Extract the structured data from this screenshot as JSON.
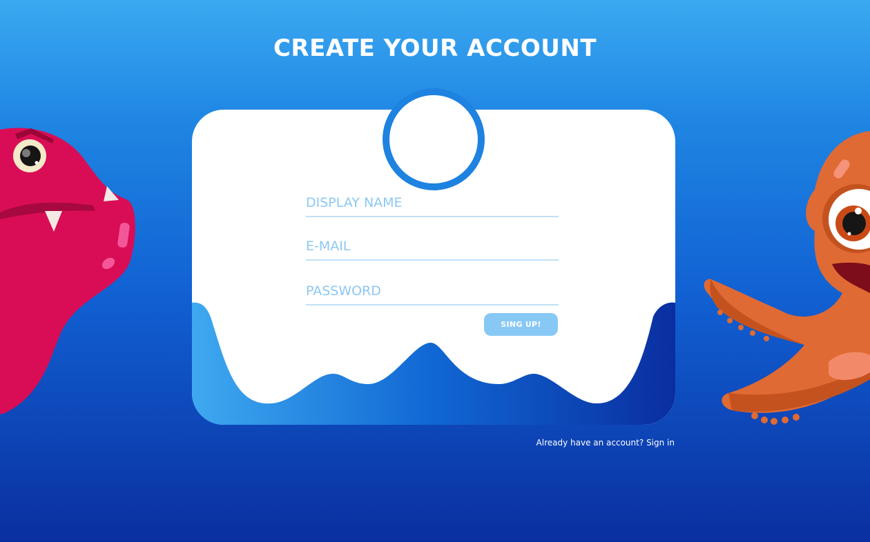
{
  "header": {
    "title": "CREATE YOUR ACCOUNT"
  },
  "form": {
    "display_name_placeholder": "DISPLAY NAME",
    "email_placeholder": "E-MAIL",
    "password_placeholder": "PASSWORD",
    "display_name_value": "",
    "email_value": "",
    "password_value": "",
    "submit_label": "SING UP!"
  },
  "footer": {
    "prompt": "Already have an account?",
    "signin_link": "Sign in"
  },
  "colors": {
    "accent": "#1e82e0",
    "button": "#88c8f5",
    "placeholder": "#8cc8f4",
    "monster_left": "#d90d55",
    "monster_right": "#e06a33"
  },
  "icons": [
    "avatar-placeholder",
    "pink-monster-illustration",
    "orange-octopus-illustration"
  ]
}
